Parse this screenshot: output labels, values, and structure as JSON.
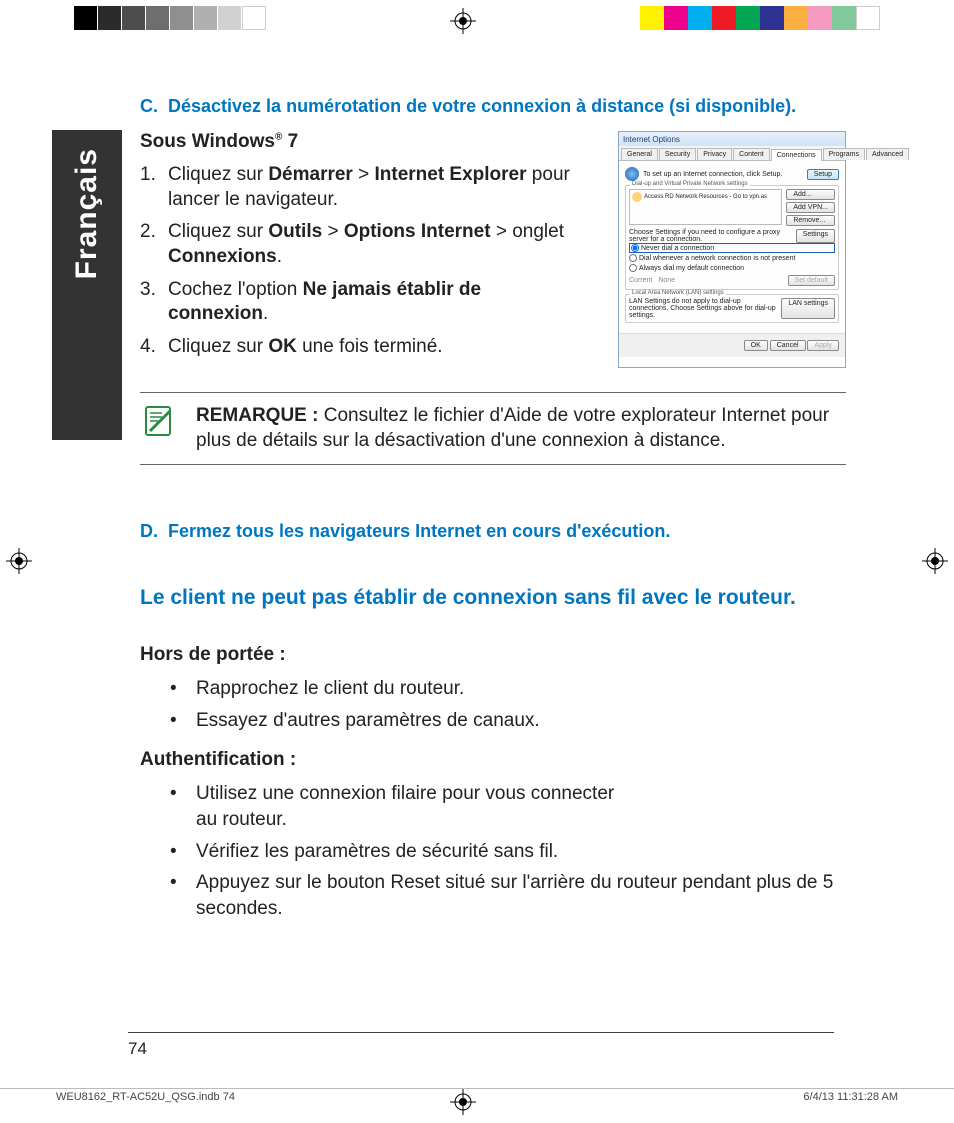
{
  "langTab": "Français",
  "sectionC": {
    "letter": "C.",
    "title": "Désactivez la numérotation de votre connexion à distance (si disponible).",
    "subhead_prefix": "Sous Windows",
    "subhead_reg": "®",
    "subhead_suffix": " 7",
    "steps": [
      {
        "pre": "Cliquez sur ",
        "b1": "Démarrer",
        "mid": " > ",
        "b2": "Internet Explorer",
        "post": " pour lancer le navigateur."
      },
      {
        "pre": "Cliquez sur ",
        "b1": "Outils",
        "mid": " > ",
        "b2": "Options Internet",
        "mid2": " > onglet ",
        "b3": "Connexions",
        "post": "."
      },
      {
        "pre": "Cochez l'option ",
        "b1": "Ne jamais établir de connexion",
        "post": "."
      },
      {
        "pre": "Cliquez sur ",
        "b1": "OK",
        "post": " une fois terminé."
      }
    ]
  },
  "dialog": {
    "title": "Internet Options",
    "tabs": [
      "General",
      "Security",
      "Privacy",
      "Content",
      "Connections",
      "Programs",
      "Advanced"
    ],
    "activeTab": "Connections",
    "setupText": "To set up an Internet connection, click Setup.",
    "setupBtn": "Setup",
    "dialupLabel": "Dial-up and Virtual Private Network settings",
    "dialupItem": "Access RD Network Resources - Go to vpn.as",
    "addBtn": "Add...",
    "addVpnBtn": "Add VPN...",
    "removeBtn": "Remove...",
    "proxyText": "Choose Settings if you need to configure a proxy server for a connection.",
    "settingsBtn": "Settings",
    "radio1": "Never dial a connection",
    "radio2": "Dial whenever a network connection is not present",
    "radio3": "Always dial my default connection",
    "currentLabel": "Current",
    "currentValue": "None",
    "setDefaultBtn": "Set default",
    "lanLabel": "Local Area Network (LAN) settings",
    "lanText": "LAN Settings do not apply to dial-up connections. Choose Settings above for dial-up settings.",
    "lanBtn": "LAN settings",
    "okBtn": "OK",
    "cancelBtn": "Cancel",
    "applyBtn": "Apply"
  },
  "note": {
    "label": "REMARQUE : ",
    "text": "Consultez le fichier d'Aide de votre explorateur Internet pour plus de détails sur la désactivation d'une connexion à distance."
  },
  "sectionD": {
    "letter": "D.",
    "title": "Fermez tous les navigateurs Internet en cours d'exécution."
  },
  "issue": {
    "title": "Le client ne peut pas établir de connexion sans fil avec le routeur.",
    "group1": {
      "head": "Hors de portée :",
      "items": [
        "Rapprochez le client du routeur.",
        "Essayez d'autres paramètres de canaux."
      ]
    },
    "group2": {
      "head": "Authentification :",
      "items": [
        "Utilisez une connexion filaire pour vous connecter au routeur.",
        "Vérifiez les paramètres de sécurité sans fil.",
        "Appuyez sur le bouton Reset situé sur l'arrière du routeur pendant plus de 5 secondes."
      ]
    }
  },
  "pageNumber": "74",
  "footer": {
    "file": "WEU8162_RT-AC52U_QSG.indb   74",
    "date": "6/4/13   11:31:28 AM"
  },
  "colorbar_left": [
    "#000000",
    "#2b2b2b",
    "#4d4d4d",
    "#6e6e6e",
    "#8f8f8f",
    "#b0b0b0",
    "#d1d1d1",
    "#ffffff"
  ],
  "colorbar_right": [
    "#fff200",
    "#ec008c",
    "#00aeef",
    "#ed1c24",
    "#00a651",
    "#2e3192",
    "#fbb040",
    "#f49ac1",
    "#82ca9c",
    "#ffffff"
  ]
}
